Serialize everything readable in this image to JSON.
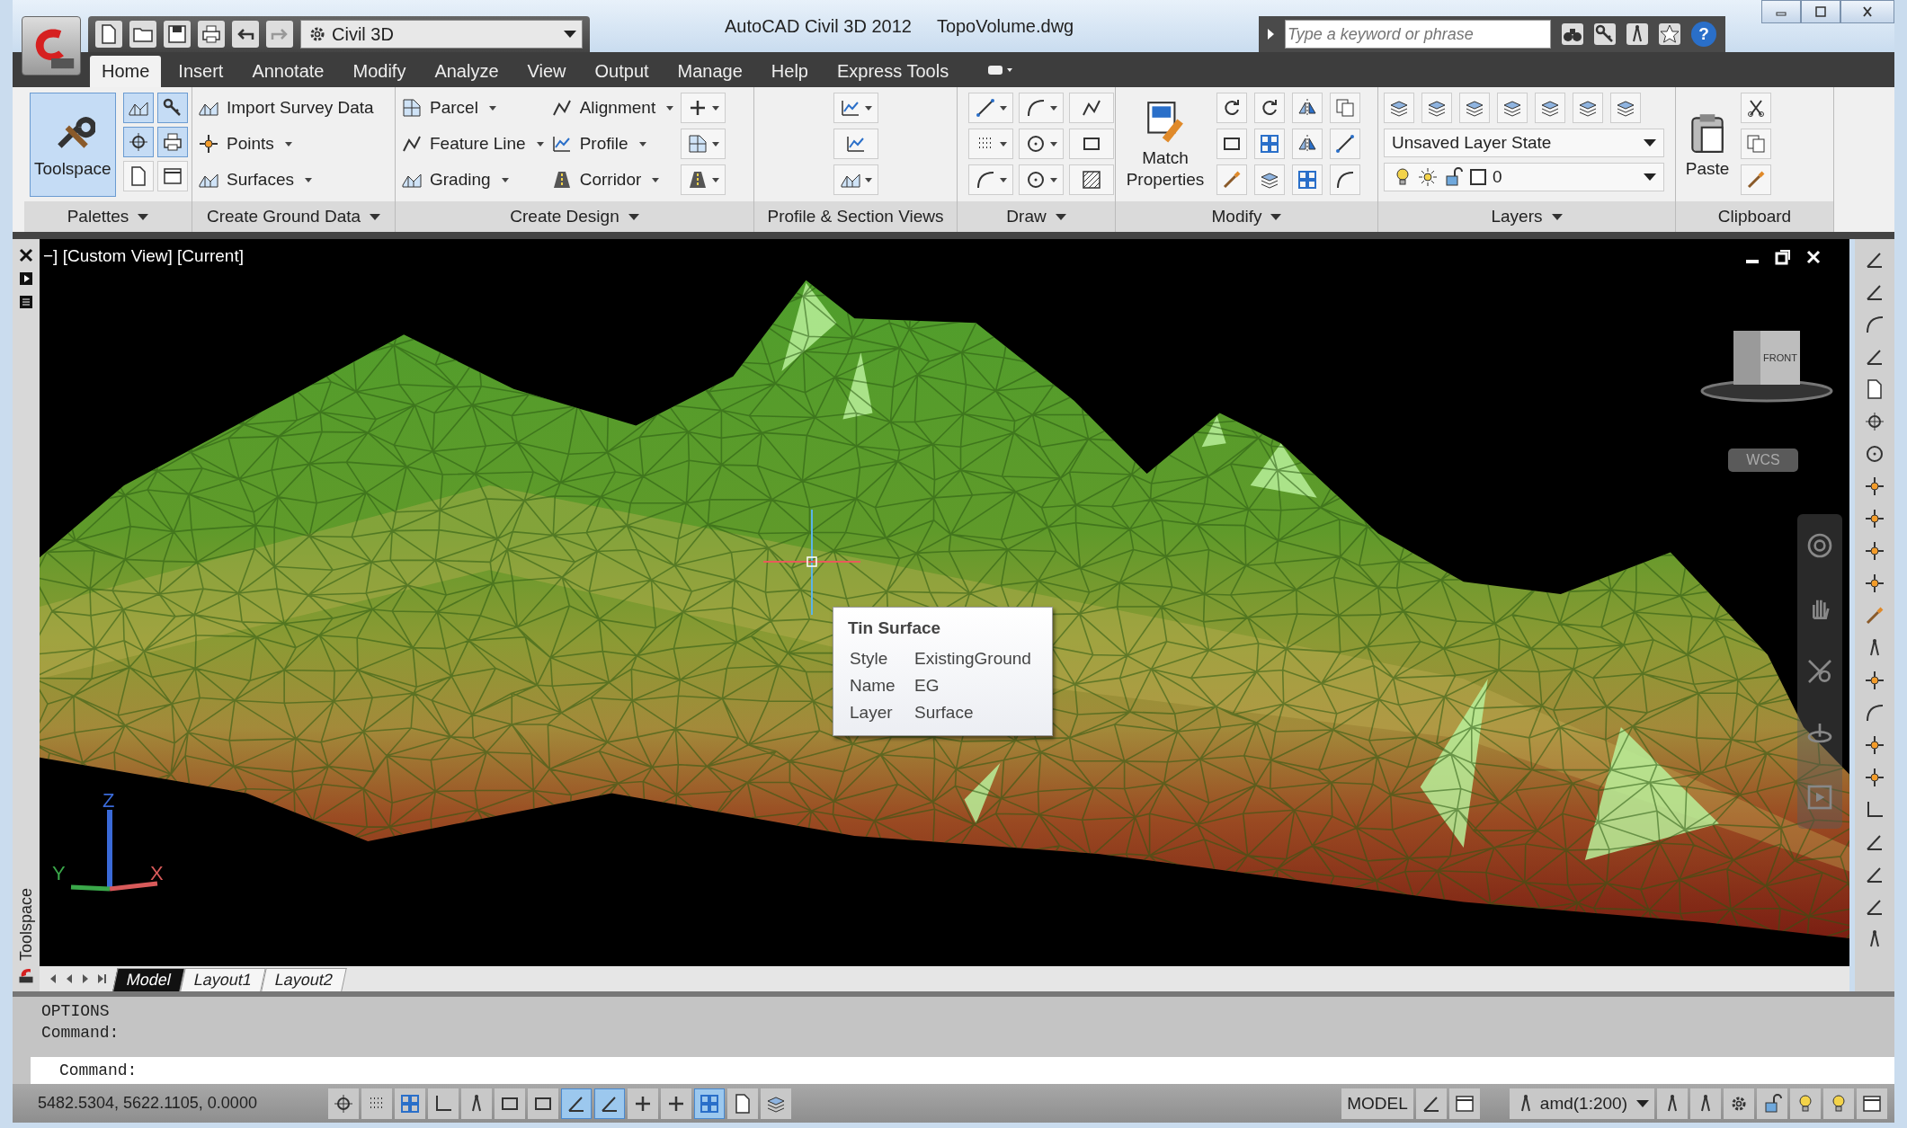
{
  "title_bar": {
    "workspace": "Civil 3D",
    "app_title": "AutoCAD Civil 3D 2012",
    "file_name": "TopoVolume.dwg",
    "search": {
      "placeholder": "Type a keyword or phrase"
    },
    "help": "?"
  },
  "tabs": [
    {
      "label": "Home",
      "selected": true
    },
    {
      "label": "Insert",
      "selected": false
    },
    {
      "label": "Annotate",
      "selected": false
    },
    {
      "label": "Modify",
      "selected": false
    },
    {
      "label": "Analyze",
      "selected": false
    },
    {
      "label": "View",
      "selected": false
    },
    {
      "label": "Output",
      "selected": false
    },
    {
      "label": "Manage",
      "selected": false
    },
    {
      "label": "Help",
      "selected": false
    },
    {
      "label": "Express Tools",
      "selected": false
    }
  ],
  "ribbon": {
    "panels": [
      {
        "kind": "palettes",
        "label": "Palettes",
        "expandable": true,
        "tool": {
          "label": "Toolspace",
          "selected": true
        },
        "toggles": [
          {
            "on": true
          },
          {
            "on": true
          },
          {
            "on": true
          },
          {
            "on": true
          },
          {
            "on": false
          },
          {
            "on": false
          }
        ]
      },
      {
        "kind": "list",
        "label": "Create Ground Data",
        "expandable": true,
        "columns": [
          [
            {
              "label": "Import Survey Data",
              "dropdown": false
            },
            {
              "label": "Points",
              "dropdown": true
            },
            {
              "label": "Surfaces",
              "dropdown": true
            }
          ]
        ]
      },
      {
        "kind": "list",
        "label": "Create Design",
        "expandable": true,
        "icon_column": true,
        "columns": [
          [
            {
              "label": "Parcel",
              "dropdown": true
            },
            {
              "label": "Feature Line",
              "dropdown": true
            },
            {
              "label": "Grading",
              "dropdown": true
            }
          ],
          [
            {
              "label": "Alignment",
              "dropdown": true
            },
            {
              "label": "Profile",
              "dropdown": true
            },
            {
              "label": "Corridor",
              "dropdown": true
            }
          ]
        ]
      },
      {
        "kind": "views",
        "label": "Profile & Section Views",
        "expandable": false
      },
      {
        "kind": "draw",
        "label": "Draw",
        "expandable": true
      },
      {
        "kind": "modify",
        "label": "Modify",
        "expandable": true,
        "tool": {
          "label": "Match Properties"
        }
      },
      {
        "kind": "layers",
        "label": "Layers",
        "expandable": true,
        "layer_state": "Unsaved Layer State",
        "current_layer": "0"
      },
      {
        "kind": "clipboard",
        "label": "Clipboard",
        "expandable": false,
        "tool": {
          "label": "Paste"
        }
      }
    ]
  },
  "palette": {
    "title": "Toolspace"
  },
  "viewport": {
    "label": "−] [Custom View] [Current]",
    "viewcube": {
      "face": "FRONT"
    },
    "ucs_menu": "WCS",
    "axes": {
      "x": "X",
      "y": "Y",
      "z": "Z"
    },
    "tooltip": {
      "title": "Tin Surface",
      "rows": [
        {
          "name": "Style",
          "value": "ExistingGround"
        },
        {
          "name": "Name",
          "value": "EG"
        },
        {
          "name": "Layer",
          "value": "Surface"
        }
      ]
    }
  },
  "layout_tabs": [
    {
      "label": "Model",
      "selected": true
    },
    {
      "label": "Layout1",
      "selected": false
    },
    {
      "label": "Layout2",
      "selected": false
    }
  ],
  "command_line": {
    "history": [
      "OPTIONS",
      "Command:"
    ],
    "prompt": "Command:"
  },
  "status_bar": {
    "coordinates": "5482.5304, 5622.1105, 0.0000",
    "toggles": [
      {
        "on": false
      },
      {
        "on": false
      },
      {
        "on": false
      },
      {
        "on": false
      },
      {
        "on": false
      },
      {
        "on": false
      },
      {
        "on": false
      },
      {
        "on": true
      },
      {
        "on": true
      },
      {
        "on": false
      },
      {
        "on": false
      },
      {
        "on": true
      },
      {
        "on": false
      },
      {
        "on": false
      }
    ],
    "space": "MODEL",
    "annotation_scale": "amd(1:200)"
  }
}
